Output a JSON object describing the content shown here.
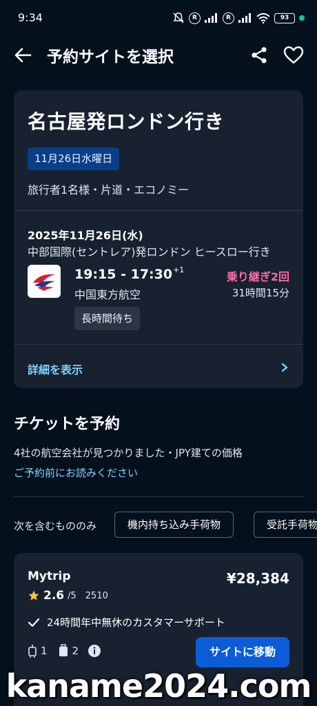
{
  "status_bar": {
    "time": "9:34",
    "battery": "93"
  },
  "header": {
    "title": "予約サイトを選択"
  },
  "summary": {
    "route_title": "名古屋発ロンドン行き",
    "date_pill": "11月26日水曜日",
    "travelers": "旅行者1名様・片道・エコノミー"
  },
  "flight": {
    "date": "2025年11月26日(水)",
    "route": "中部国際(セントレア)発ロンドン ヒースロー行き",
    "times": "19:15 - 17:30",
    "day_offset": "+1",
    "airline": "中国東方航空",
    "stops": "乗り継ぎ2回",
    "duration": "31時間15分",
    "tag": "長時間待ち",
    "details_link": "詳細を表示"
  },
  "booking": {
    "section_title": "チケットを予約",
    "found_text": "4社の航空会社が見つかりました・JPY建ての価格",
    "read_before_link": "ご予約前にお読みください"
  },
  "filters": {
    "label": "次を含むもののみ",
    "chips": [
      "機内持ち込み手荷物",
      "受託手荷物"
    ]
  },
  "offers": [
    {
      "name": "Mytrip",
      "price": "¥28,384",
      "rating": "2.6",
      "rating_out_of": "/5",
      "review_count": "2510",
      "feature": "24時間年中無休のカスタマーサポート",
      "cabin_bags": "1",
      "checked_bags": "2",
      "button_label": "サイトに移動"
    }
  ],
  "watermark": "kaname2024.com",
  "colors": {
    "background": "#05101d",
    "card": "#17212f",
    "accent_link": "#7fd3ff",
    "stops_pink": "#ff6aa1",
    "date_pill": "#0b3e88",
    "primary_button": "#0b5cd6",
    "airline_logo_red": "#d6203a",
    "airline_logo_blue": "#1a3a8c",
    "star": "#f6c342"
  }
}
